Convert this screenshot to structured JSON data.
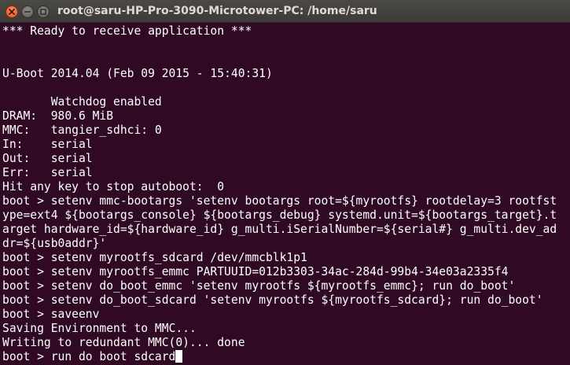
{
  "window": {
    "title": "root@saru-HP-Pro-3090-Microtower-PC: /home/saru",
    "buttons": {
      "close": "close-icon",
      "minimize": "minimize-icon",
      "maximize": "maximize-icon"
    }
  },
  "terminal": {
    "lines": [
      "*** Ready to receive application ***",
      "",
      "",
      "U-Boot 2014.04 (Feb 09 2015 - 15:40:31)",
      "",
      "       Watchdog enabled",
      "DRAM:  980.6 MiB",
      "MMC:   tangier_sdhci: 0",
      "In:    serial",
      "Out:   serial",
      "Err:   serial",
      "Hit any key to stop autoboot:  0",
      "boot > setenv mmc-bootargs 'setenv bootargs root=${myrootfs} rootdelay=3 rootfst",
      "ype=ext4 ${bootargs_console} ${bootargs_debug} systemd.unit=${bootargs_target}.t",
      "arget hardware_id=${hardware_id} g_multi.iSerialNumber=${serial#} g_multi.dev_ad",
      "dr=${usb0addr}'",
      "boot > setenv myrootfs_sdcard /dev/mmcblk1p1",
      "boot > setenv myrootfs_emmc PARTUUID=012b3303-34ac-284d-99b4-34e03a2335f4",
      "boot > setenv do_boot_emmc 'setenv myrootfs ${myrootfs_emmc}; run do_boot'",
      "boot > setenv do_boot_sdcard 'setenv myrootfs ${myrootfs_sdcard}; run do_boot'",
      "boot > saveenv",
      "Saving Environment to MMC...",
      "Writing to redundant MMC(0)... done"
    ],
    "prompt_line": "boot > run do_boot_sdcard"
  },
  "colors": {
    "background": "#300a24",
    "foreground": "#ffffff",
    "titlebar": "#3c3b37",
    "close_button": "#e9541f"
  }
}
